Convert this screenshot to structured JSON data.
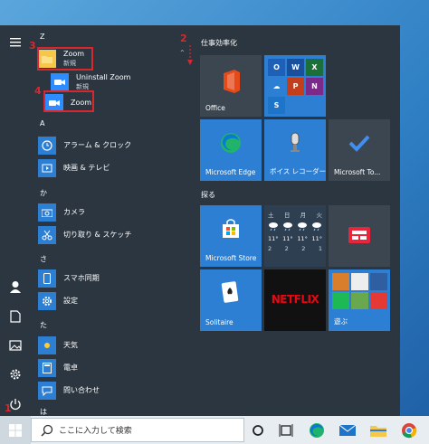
{
  "menu": {
    "sections": {
      "z": "Z",
      "ka": "か",
      "sa": "さ",
      "ta": "た",
      "ha": "は"
    },
    "apps": {
      "zoom_folder": {
        "label": "Zoom",
        "sub": "新規"
      },
      "uninstall_zoom": {
        "label": "Uninstall Zoom",
        "sub": "新規"
      },
      "zoom": {
        "label": "Zoom"
      },
      "alarm": {
        "label": "アラーム & クロック"
      },
      "movies": {
        "label": "映画 & テレビ"
      },
      "camera": {
        "label": "カメラ"
      },
      "snip": {
        "label": "切り取り & スケッチ"
      },
      "phone": {
        "label": "スマホ同期"
      },
      "settings": {
        "label": "設定"
      },
      "weather": {
        "label": "天気"
      },
      "calc": {
        "label": "電卓"
      },
      "help": {
        "label": "問い合わせ"
      }
    },
    "badges": {
      "b1": "1",
      "b2": "2",
      "b3": "3",
      "b4": "4"
    }
  },
  "tiles": {
    "group1_title": "仕事効率化",
    "group2_title": "探る",
    "office": "Office",
    "edge": "Microsoft Edge",
    "recorder": "ボイス レコーダー",
    "todo": "Microsoft To...",
    "store": "Microsoft Store",
    "netflix": "NETFLIX",
    "solitaire": "Solitaire",
    "play": "遊ぶ",
    "weather_temps": [
      "11°",
      "11°",
      "11°",
      "11°"
    ],
    "weather_days": [
      "土",
      "日",
      "月",
      "火"
    ],
    "weather_times": [
      "2",
      "2",
      "2",
      "1"
    ]
  },
  "taskbar": {
    "search_placeholder": "ここに入力して検索"
  },
  "colors": {
    "highlight": "#d8282d",
    "tile_blue": "#2d7fd3",
    "menu_bg": "#2b3640"
  }
}
